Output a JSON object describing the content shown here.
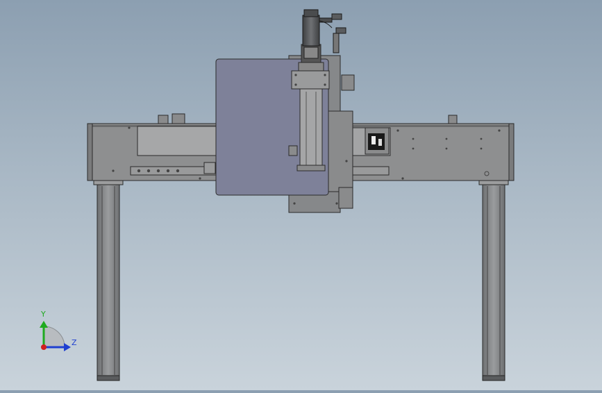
{
  "viewport": {
    "background_top": "#8c9fb1",
    "background_bottom": "#c9d3db"
  },
  "model": {
    "body_color": "#8f9091",
    "panel_color": "#7c7f96",
    "edge_color": "#2a2a2a",
    "rail_color": "#a4a5a6"
  },
  "triad": {
    "y_label": "Y",
    "z_label": "Z",
    "y_color": "#1faa1f",
    "z_color": "#1f3fd0",
    "x_color": "#d01f1f"
  }
}
